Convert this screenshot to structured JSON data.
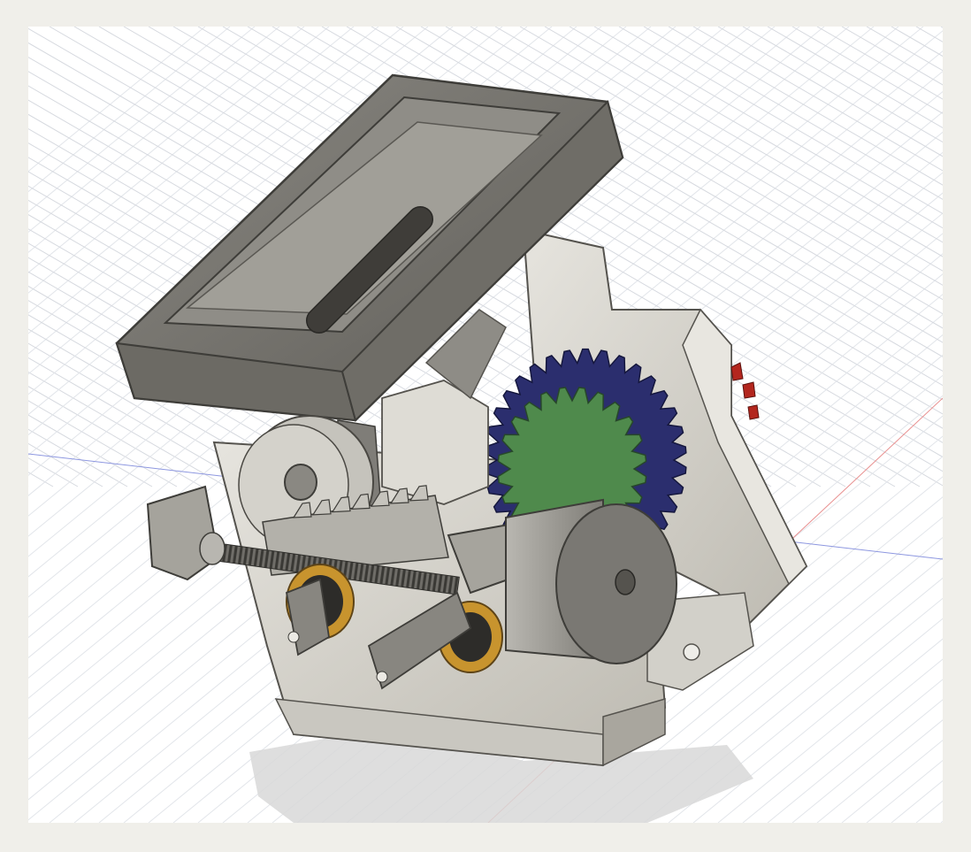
{
  "app": {
    "view": "3d-model-viewport",
    "background": "#f0efea",
    "viewport_background": "#ffffff"
  },
  "scene": {
    "grid": true,
    "axes": {
      "x_axis_color": "#6a7bd8",
      "y_axis_color": "#e07070"
    },
    "model_colors": {
      "body": "#d8d6cf",
      "body_shade": "#b9b6ad",
      "carriage": "#77756f",
      "carriage_dark": "#4a4843",
      "gear_blue": "#2b2e6e",
      "gear_green": "#4f8a4c",
      "bushing": "#c8942e",
      "red_part": "#b3261e"
    },
    "icons": [
      "gear-icon",
      "screw-icon",
      "motor-icon"
    ]
  }
}
